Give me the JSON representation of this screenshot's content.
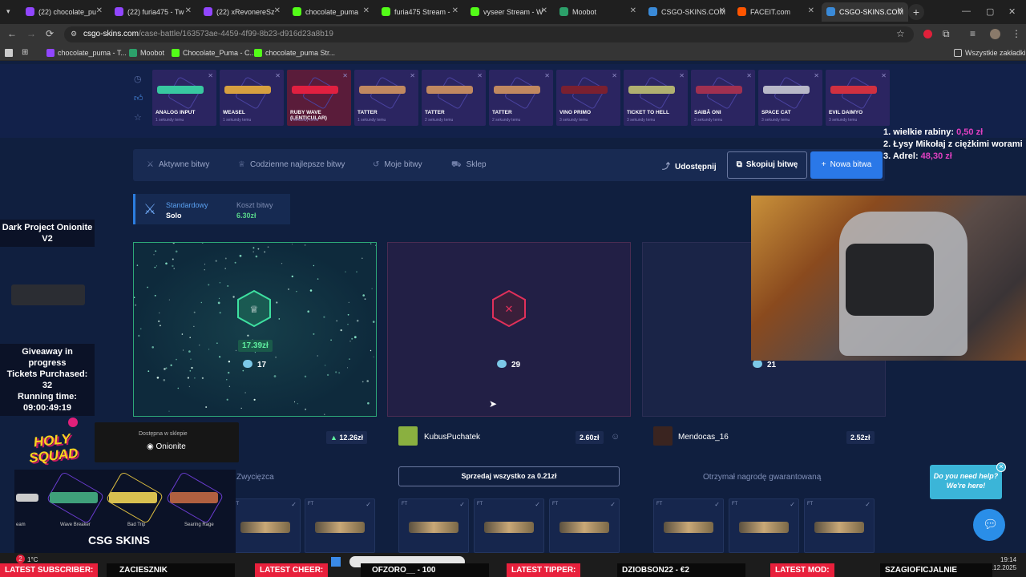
{
  "browser": {
    "tabs": [
      {
        "label": "(22) chocolate_pu",
        "color": "#9146ff"
      },
      {
        "label": "(22) furia475 - Tw",
        "color": "#9146ff"
      },
      {
        "label": "(22) xRevonereSz",
        "color": "#9146ff"
      },
      {
        "label": "chocolate_puma",
        "color": "#53fc18"
      },
      {
        "label": "furia475 Stream -",
        "color": "#53fc18"
      },
      {
        "label": "vyseer Stream - W",
        "color": "#53fc18"
      },
      {
        "label": "Moobot",
        "color": "#2ca06a"
      },
      {
        "label": "CSGO-SKINS.COM",
        "color": "#3a8ad8"
      },
      {
        "label": "FACEIT.com",
        "color": "#ff5500"
      },
      {
        "label": "CSGO-SKINS.COM",
        "color": "#3a8ad8"
      }
    ],
    "url_host": "csgo-skins.com",
    "url_path": "/case-battle/163573ae-4459-4f99-8b23-d916d23a8b19",
    "bookmarks": [
      {
        "label": "chocolate_puma - T...",
        "color": "#9146ff"
      },
      {
        "label": "Moobot",
        "color": "#2ca06a"
      },
      {
        "label": "Chocolate_Puma - C...",
        "color": "#53fc18"
      },
      {
        "label": "chocolate_puma Str...",
        "color": "#53fc18"
      }
    ],
    "all_bookmarks": "Wszystkie zakładki"
  },
  "feed": [
    {
      "name": "ANALOG INPUT",
      "sub": "1 sekundy temu",
      "bg": "#2b2561",
      "gun": "#38c8a0"
    },
    {
      "name": "WEASEL",
      "sub": "1 sekundy temu",
      "bg": "#2b2561",
      "gun": "#d6a040"
    },
    {
      "name": "RUBY WAVE (LENTICULAR)",
      "sub": "1 sekundy temu",
      "bg": "#5a1c3a",
      "gun": "#e02040"
    },
    {
      "name": "TATTER",
      "sub": "1 sekundy temu",
      "bg": "#2b2561",
      "gun": "#c08860"
    },
    {
      "name": "TATTER",
      "sub": "2 sekundy temu",
      "bg": "#2b2561",
      "gun": "#c08860"
    },
    {
      "name": "TATTER",
      "sub": "2 sekundy temu",
      "bg": "#2b2561",
      "gun": "#c08860"
    },
    {
      "name": "VINO PRIMO",
      "sub": "3 sekundy temu",
      "bg": "#2b2561",
      "gun": "#7a2030"
    },
    {
      "name": "TICKET TO HELL",
      "sub": "3 sekundy temu",
      "bg": "#2b2561",
      "gun": "#b0b070"
    },
    {
      "name": "SAIBĀ ONI",
      "sub": "3 sekundy temu",
      "bg": "#2b2561",
      "gun": "#a03050"
    },
    {
      "name": "SPACE CAT",
      "sub": "3 sekundy temu",
      "bg": "#2b2561",
      "gun": "#b8b8c8"
    },
    {
      "name": "EVIL DAIMYO",
      "sub": "3 sekundy temu",
      "bg": "#2b2561",
      "gun": "#d03040"
    }
  ],
  "menu": {
    "active": "Aktywne bitwy",
    "daily": "Codzienne najlepsze bitwy",
    "mine": "Moje bitwy",
    "shop": "Sklep",
    "share": "Udostępnij",
    "copy": "Skopiuj bitwę",
    "new": "Nowa bitwa"
  },
  "mode": {
    "type": "Standardowy",
    "variant": "Solo",
    "cost_label": "Koszt bitwy",
    "cost": "6.30zł"
  },
  "players": [
    {
      "name": "",
      "value": "12.26zł",
      "coins": "17",
      "win_price": "17.39zł",
      "result": "Zwycięzca"
    },
    {
      "name": "KubusPuchatek",
      "value": "2.60zł",
      "coins": "29",
      "sell": "Sprzedaj wszystko za 0.21zł"
    },
    {
      "name": "Mendocas_16",
      "value": "2.52zł",
      "coins": "21",
      "result": "Otrzymał nagrodę gwarantowaną"
    }
  ],
  "card_label": "FT",
  "overlay": {
    "leaders": [
      {
        "text": "1. wielkie rabiny:",
        "amount": "0,50 zł"
      },
      {
        "text": "2. Łysy Mikołaj z ciężkimi worami",
        "amount": ""
      },
      {
        "text": "3. Adrel:",
        "amount": "48,30 zł"
      }
    ],
    "kbd_title": "Dark Project Onionite V2",
    "giveaway": [
      "Giveaway in",
      "progress",
      "Tickets Purchased:",
      "32",
      "Running time:",
      "09:00:49:19"
    ],
    "holy": "HOLY SQUAD",
    "shop_avail": "Dostępna w sklepie",
    "shop_item": "Onionite",
    "skins": [
      "eam",
      "Wave Breaker",
      "Bad Trip",
      "Searing Rage"
    ],
    "brand": "CSG SKINS",
    "help": "Do you need help? We're here!"
  },
  "ticker": {
    "sub_label": "LATEST SUBSCRIBER:",
    "sub": "ZACIESZNIK",
    "cheer_label": "LATEST CHEER:",
    "cheer": "OFZORO__ - 100",
    "tip_label": "LATEST TIPPER:",
    "tip": "DZIOBSON22 - €2",
    "mod_label": "LATEST MOD:",
    "mod": "SZAGIOFICJALNIE"
  },
  "tray": {
    "temp": "1°C",
    "time": "19:14",
    "date": "19.12.2025",
    "badge": "2"
  }
}
